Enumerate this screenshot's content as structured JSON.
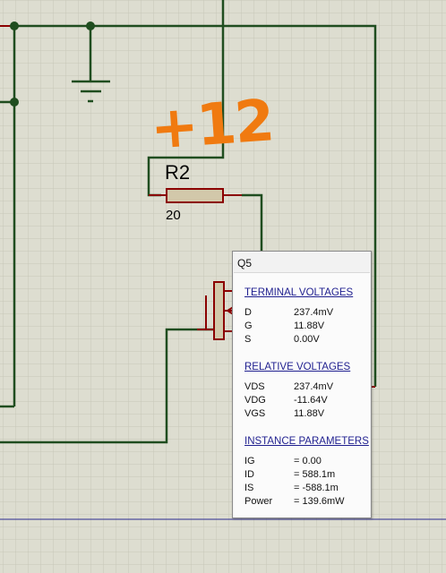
{
  "schematic": {
    "resistor": {
      "name": "R2",
      "value": "20"
    },
    "annotation": "+12",
    "colors": {
      "wire": "#1f4d1f",
      "pin": "#8b0000",
      "component_fill": "#d2c8aa",
      "grid_bg": "#ddddd0",
      "grid_line": "#c5c5b8",
      "annotation": "#f07a10",
      "guide_line": "#2b2b8f"
    }
  },
  "popup": {
    "title": "Q5",
    "terminal_voltages": {
      "heading": "TERMINAL VOLTAGES",
      "rows": [
        {
          "name": "D",
          "value": "237.4mV"
        },
        {
          "name": "G",
          "value": "11.88V"
        },
        {
          "name": "S",
          "value": "0.00V"
        }
      ]
    },
    "relative_voltages": {
      "heading": "RELATIVE VOLTAGES",
      "rows": [
        {
          "name": "VDS",
          "value": "237.4mV"
        },
        {
          "name": "VDG",
          "value": "-11.64V"
        },
        {
          "name": "VGS",
          "value": "11.88V"
        }
      ]
    },
    "instance_parameters": {
      "heading": "INSTANCE PARAMETERS",
      "rows": [
        {
          "name": "IG",
          "value": "=  0.00"
        },
        {
          "name": "ID",
          "value": "=  588.1m"
        },
        {
          "name": "IS",
          "value": "=  -588.1m"
        },
        {
          "name": "Power",
          "value": "=  139.6mW"
        }
      ]
    }
  }
}
